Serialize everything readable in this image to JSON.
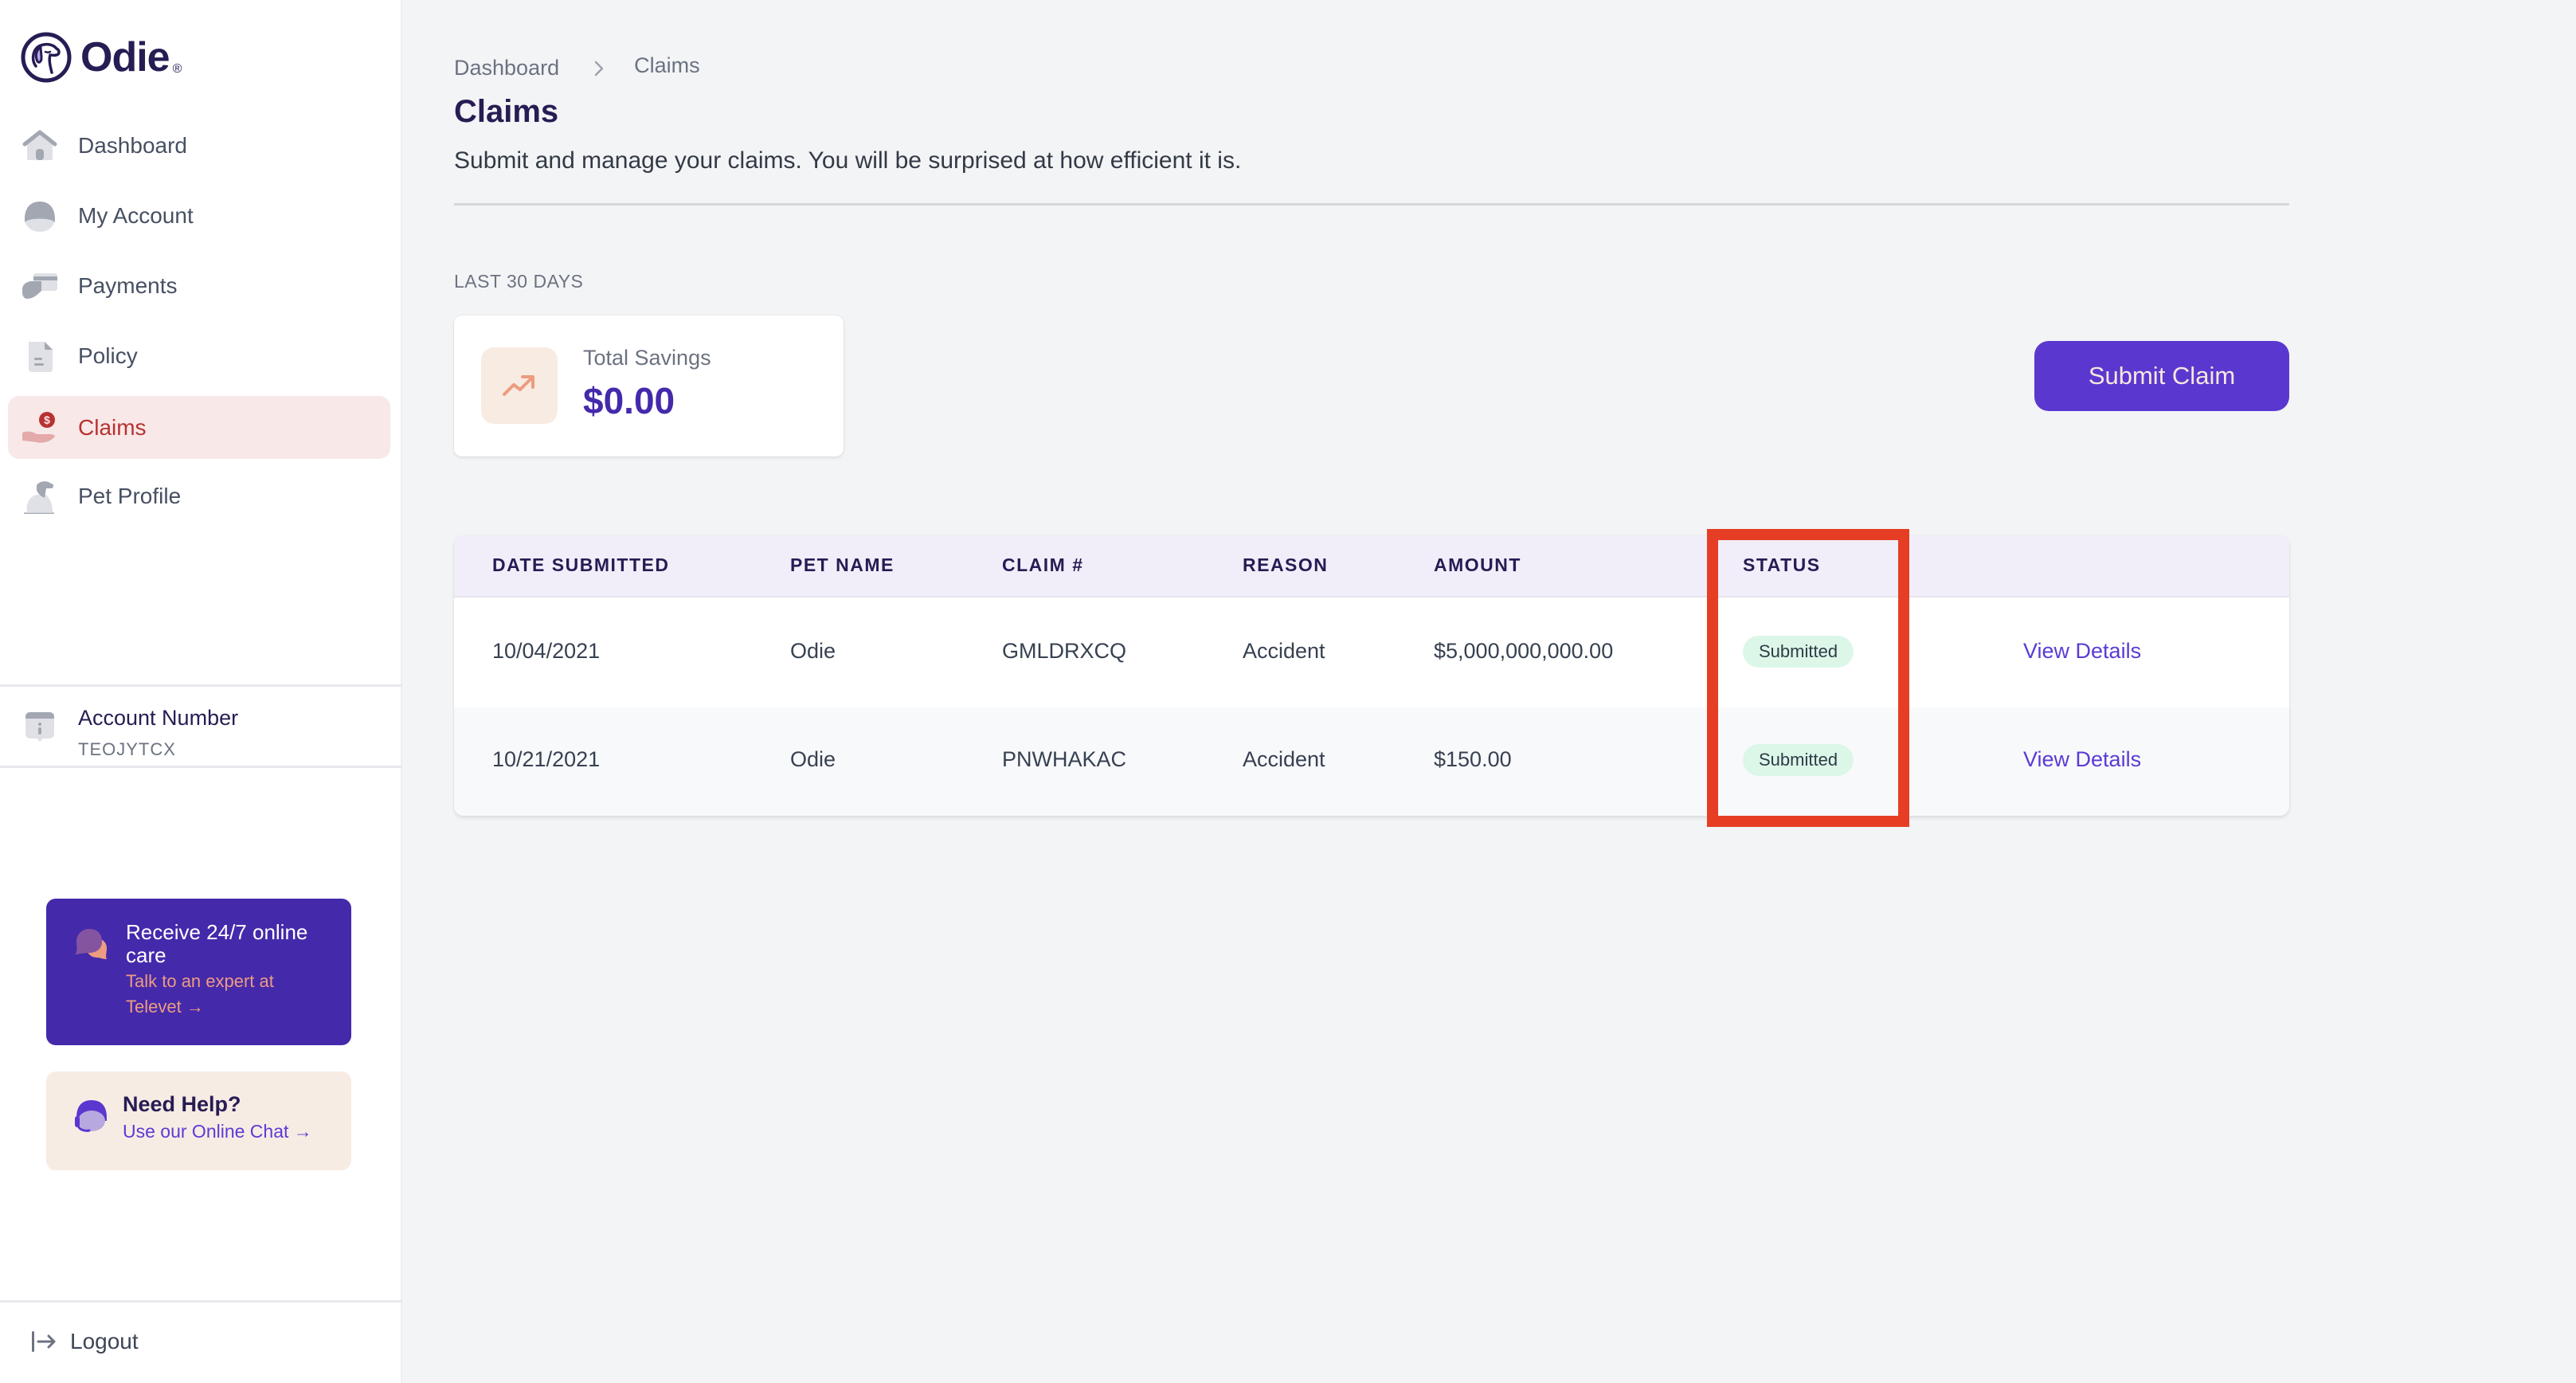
{
  "brand": {
    "name": "Odie",
    "registered_mark": "®"
  },
  "sidebar": {
    "items": [
      {
        "label": "Dashboard",
        "icon": "home-icon",
        "active": false
      },
      {
        "label": "My Account",
        "icon": "user-icon",
        "active": false
      },
      {
        "label": "Payments",
        "icon": "credit-card-icon",
        "active": false
      },
      {
        "label": "Policy",
        "icon": "document-icon",
        "active": false
      },
      {
        "label": "Claims",
        "icon": "hand-coin-icon",
        "active": true
      },
      {
        "label": "Pet Profile",
        "icon": "dog-icon",
        "active": false
      }
    ],
    "account": {
      "title": "Account Number",
      "value": "TEOJYTCX"
    },
    "televet": {
      "title": "Receive 24/7 online care",
      "link": "Talk to an expert at Televet →"
    },
    "help": {
      "title": "Need Help?",
      "link": "Use our Online Chat →"
    },
    "logout_label": "Logout"
  },
  "breadcrumb": {
    "items": [
      "Dashboard",
      "Claims"
    ]
  },
  "page": {
    "title": "Claims",
    "subtitle": "Submit and manage your claims. You will be surprised at how efficient it is."
  },
  "stats": {
    "period_label": "LAST 30 DAYS",
    "total_savings_label": "Total Savings",
    "total_savings_value": "$0.00"
  },
  "actions": {
    "submit_claim_label": "Submit Claim"
  },
  "table": {
    "columns": [
      "DATE SUBMITTED",
      "PET NAME",
      "CLAIM #",
      "REASON",
      "AMOUNT",
      "STATUS"
    ],
    "rows": [
      {
        "date": "10/04/2021",
        "pet": "Odie",
        "claim": "GMLDRXCQ",
        "reason": "Accident",
        "amount": "$5,000,000,000.00",
        "status": "Submitted",
        "action": "View Details"
      },
      {
        "date": "10/21/2021",
        "pet": "Odie",
        "claim": "PNWHAKAC",
        "reason": "Accident",
        "amount": "$150.00",
        "status": "Submitted",
        "action": "View Details"
      }
    ]
  },
  "colors": {
    "brand_dark": "#271c53",
    "primary": "#5a38d0",
    "active_nav_bg": "#f8e8e8",
    "active_nav_text": "#b83232",
    "status_submitted_bg": "#dcf7e8",
    "highlight": "#e53e25"
  }
}
